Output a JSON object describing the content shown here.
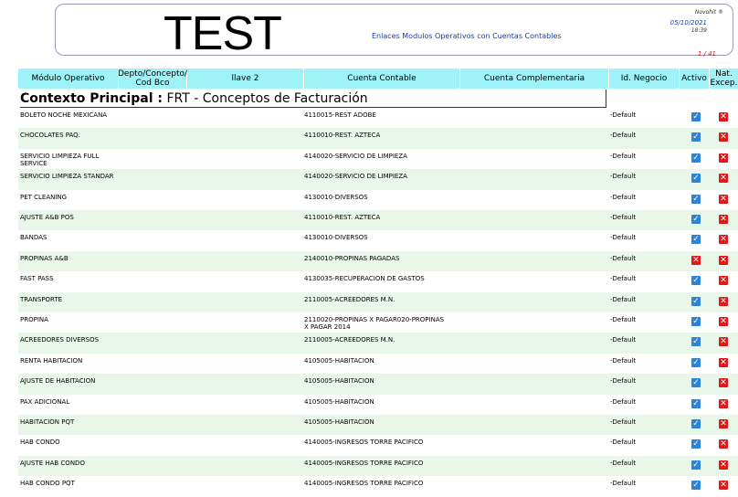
{
  "header": {
    "title": "TEST",
    "subtitle": "Enlaces Modulos Operativos con Cuentas Contables",
    "company": "Novohit ®",
    "date": "05/10/2021",
    "time": "18:39",
    "page": "1 /   41"
  },
  "columns": {
    "modulo": "Módulo Operativo",
    "depto": "Depto/Concepto/ Cod Bco",
    "llave": "llave 2",
    "cuenta": "Cuenta Contable",
    "complementaria": "Cuenta Complementaria",
    "negocio": "Id. Negocio",
    "activo": "Activo",
    "nat": "Nat. Excep."
  },
  "context": {
    "label": "Contexto Principal :",
    "value": "FRT - Conceptos de Facturación"
  },
  "icons": {
    "check": "checkbox-checked-icon",
    "x": "x-mark-icon"
  },
  "colors": {
    "header_bg": "#9df3f7",
    "row_shade": "#e9f7ea",
    "check": "#2d83d8",
    "x": "#e01818"
  },
  "rows": [
    {
      "modulo": "BOLETO NOCHE MEXICANA",
      "cuenta": "4110015-REST ADOBE",
      "negocio": "-Default",
      "activo": "check",
      "nat": "x"
    },
    {
      "modulo": "CHOCOLATES PAQ.",
      "cuenta": "4110010-REST. AZTECA",
      "negocio": "-Default",
      "activo": "check",
      "nat": "x"
    },
    {
      "modulo": "SERVICIO LIMPIEZA FULL SERVICE",
      "cuenta": "4140020-SERVICIO DE LIMPIEZA",
      "negocio": "-Default",
      "activo": "check",
      "nat": "x"
    },
    {
      "modulo": "SERVICIO LIMPIEZA STANDAR",
      "cuenta": "4140020-SERVICIO DE LIMPIEZA",
      "negocio": "-Default",
      "activo": "check",
      "nat": "x"
    },
    {
      "modulo": " PET CLEANING",
      "cuenta": "4130010-DIVERSOS",
      "negocio": "-Default",
      "activo": "check",
      "nat": "x"
    },
    {
      "modulo": "AJUSTE A&B POS",
      "cuenta": "4110010-REST. AZTECA",
      "negocio": "-Default",
      "activo": "check",
      "nat": "x"
    },
    {
      "modulo": "BANDAS",
      "cuenta": "4130010-DIVERSOS",
      "negocio": "-Default",
      "activo": "check",
      "nat": "x"
    },
    {
      "modulo": "PROPINAS A&B",
      "cuenta": "2140010-PROPINAS PAGADAS",
      "negocio": "-Default",
      "activo": "x",
      "nat": "x"
    },
    {
      "modulo": "FAST PASS",
      "cuenta": "4130035-RECUPERACION DE GASTOS",
      "negocio": "-Default",
      "activo": "check",
      "nat": "x"
    },
    {
      "modulo": "TRANSPORTE",
      "cuenta": "2110005-ACREEDORES M.N.",
      "negocio": "-Default",
      "activo": "check",
      "nat": "x"
    },
    {
      "modulo": "PROPINA",
      "cuenta": "2110020-PROPINAS X PAGAR020-PROPINAS X PAGAR 2014",
      "negocio": "-Default",
      "activo": "check",
      "nat": "x"
    },
    {
      "modulo": "ACREEDORES DIVERSOS",
      "cuenta": "2110005-ACREEDORES M.N.",
      "negocio": "-Default",
      "activo": "check",
      "nat": "x"
    },
    {
      "modulo": "RENTA HABITACION",
      "cuenta": "4105005-HABITACION",
      "negocio": "-Default",
      "activo": "check",
      "nat": "x"
    },
    {
      "modulo": "AJUSTE DE HABITACION",
      "cuenta": "4105005-HABITACION",
      "negocio": "-Default",
      "activo": "check",
      "nat": "x"
    },
    {
      "modulo": "PAX ADICIONAL",
      "cuenta": "4105005-HABITACION",
      "negocio": "-Default",
      "activo": "check",
      "nat": "x"
    },
    {
      "modulo": "HABITACION PQT",
      "cuenta": "4105005-HABITACION",
      "negocio": "-Default",
      "activo": "check",
      "nat": "x"
    },
    {
      "modulo": "HAB CONDO",
      "cuenta": "4140005-INGRESOS TORRE PACIFICO",
      "negocio": "-Default",
      "activo": "check",
      "nat": "x"
    },
    {
      "modulo": "AJUSTE HAB CONDO",
      "cuenta": "4140005-INGRESOS TORRE PACIFICO",
      "negocio": "-Default",
      "activo": "check",
      "nat": "x"
    },
    {
      "modulo": "HAB CONDO PQT",
      "cuenta": "4140005-INGRESOS TORRE PACIFICO",
      "negocio": "-Default",
      "activo": "check",
      "nat": "x"
    }
  ]
}
